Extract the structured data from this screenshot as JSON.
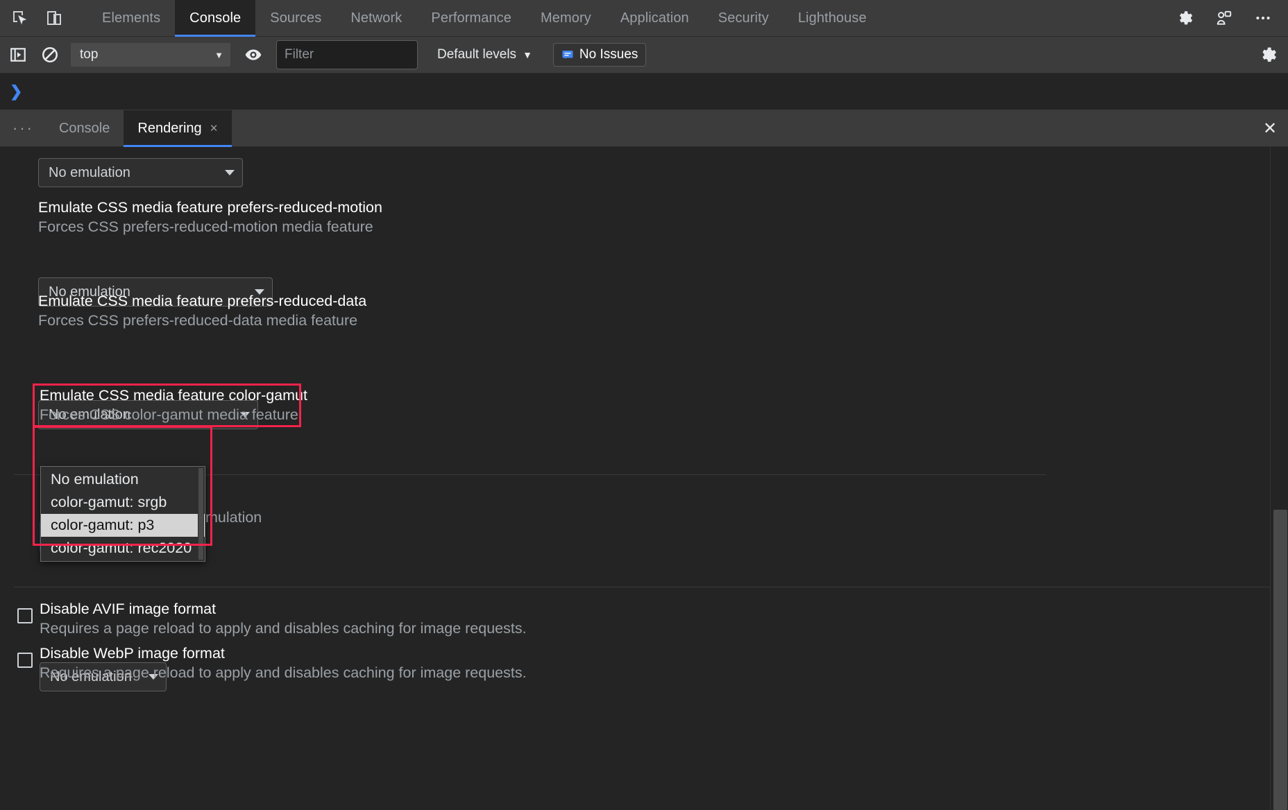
{
  "devtools": {
    "main_tabs": [
      {
        "label": "Elements",
        "active": false
      },
      {
        "label": "Console",
        "active": true
      },
      {
        "label": "Sources",
        "active": false
      },
      {
        "label": "Network",
        "active": false
      },
      {
        "label": "Performance",
        "active": false
      },
      {
        "label": "Memory",
        "active": false
      },
      {
        "label": "Application",
        "active": false
      },
      {
        "label": "Security",
        "active": false
      },
      {
        "label": "Lighthouse",
        "active": false
      }
    ],
    "icons": {
      "inspect": "inspect-element-icon",
      "device": "device-toolbar-icon",
      "settings": "gear-icon",
      "accounts": "profile-icon",
      "more": "more-vertical-icon"
    }
  },
  "console_toolbar": {
    "sidebar_toggle": "show-console-sidebar-icon",
    "clear": "clear-console-icon",
    "context": "top",
    "context_caret": "▼",
    "eye_icon": "live-expression-icon",
    "filter_placeholder": "Filter",
    "filter_value": "",
    "levels_label": "Default levels",
    "levels_caret": "▼",
    "issues_label": "No Issues",
    "issues_icon": "issues-message-icon",
    "settings_icon": "gear-icon"
  },
  "console_prompt": {
    "caret": "❯"
  },
  "drawer": {
    "more_label": "···",
    "tabs": [
      {
        "label": "Console",
        "active": false,
        "closable": false
      },
      {
        "label": "Rendering",
        "active": true,
        "closable": true,
        "close_glyph": "×"
      }
    ],
    "close_glyph": "✕"
  },
  "rendering": {
    "top_select_value": "No emulation",
    "settings": [
      {
        "title": "Emulate CSS media feature prefers-reduced-motion",
        "subtitle": "Forces CSS prefers-reduced-motion media feature",
        "select_value": "No emulation"
      },
      {
        "title": "Emulate CSS media feature prefers-reduced-data",
        "subtitle": "Forces CSS prefers-reduced-data media feature",
        "select_value": "No emulation"
      },
      {
        "title": "Emulate CSS media feature color-gamut",
        "subtitle": "Forces CSS color-gamut media feature",
        "select_value": "No emulation"
      }
    ],
    "occluded_label": "mulation",
    "color_gamut_options": [
      {
        "label": "No emulation",
        "highlighted": false
      },
      {
        "label": "color-gamut: srgb",
        "highlighted": false
      },
      {
        "label": "color-gamut: p3",
        "highlighted": true
      },
      {
        "label": "color-gamut: rec2020",
        "highlighted": false
      }
    ],
    "bottom_select_value": "No emulation",
    "checkboxes": [
      {
        "title": "Disable AVIF image format",
        "subtitle": "Requires a page reload to apply and disables caching for image requests.",
        "checked": false
      },
      {
        "title": "Disable WebP image format",
        "subtitle": "Requires a page reload to apply and disables caching for image requests.",
        "checked": false
      }
    ]
  },
  "colors": {
    "accent_blue": "#4286f4",
    "annotation_red": "#f4234b",
    "panel_bg": "#242424",
    "toolbar_bg": "#3c3c3c",
    "highlight_option_bg": "#d4d4d4"
  }
}
